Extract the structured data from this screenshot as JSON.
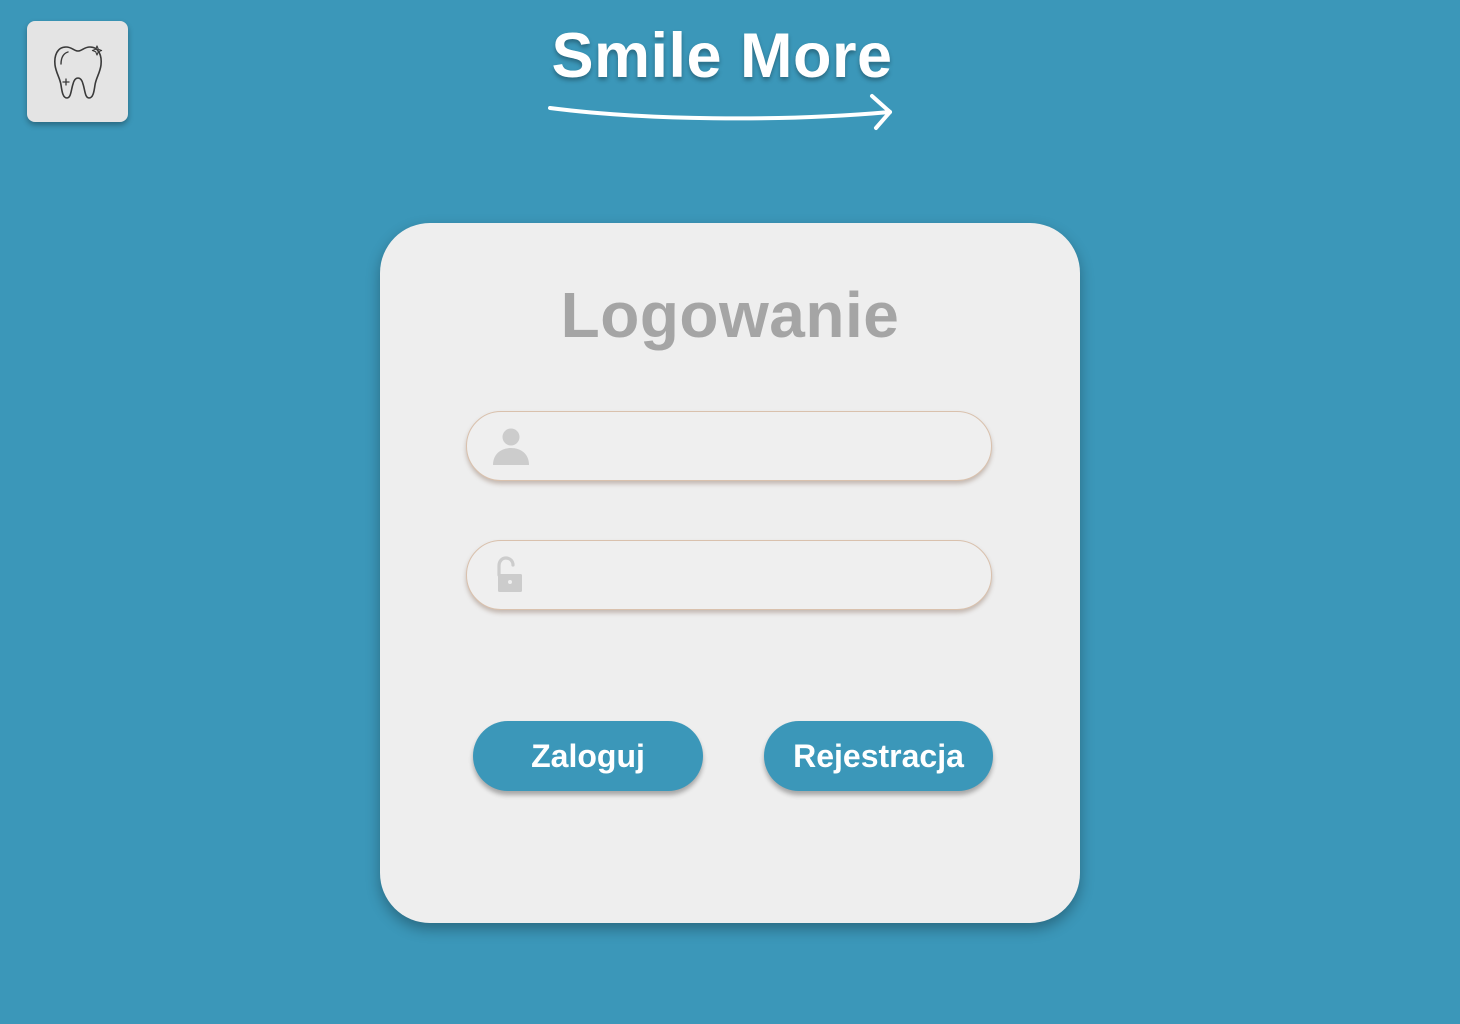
{
  "app": {
    "logo_icon": "tooth-icon",
    "brand_title": "Smile More",
    "accent_color": "#3b97b9"
  },
  "login_card": {
    "title": "Logowanie",
    "username_field": {
      "icon": "user-icon",
      "value": "",
      "placeholder": ""
    },
    "password_field": {
      "icon": "unlock-icon",
      "value": "",
      "placeholder": ""
    },
    "login_button": "Zaloguj",
    "register_button": "Rejestracja"
  }
}
